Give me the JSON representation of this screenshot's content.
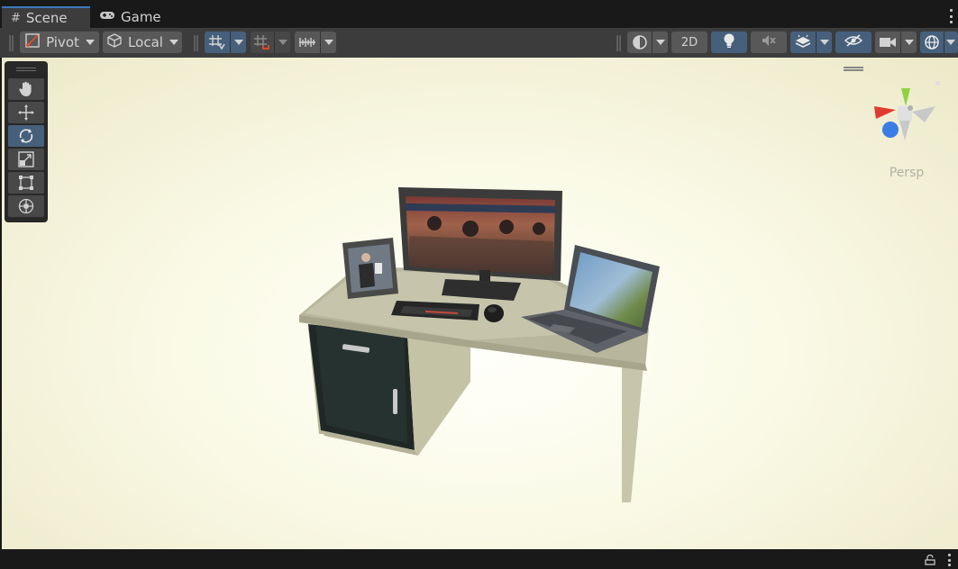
{
  "tabs": [
    {
      "label": "Scene",
      "icon": "hash-icon",
      "active": true
    },
    {
      "label": "Game",
      "icon": "gamepad-icon",
      "active": false
    }
  ],
  "toolbar": {
    "pivot_label": "Pivot",
    "space_label": "Local",
    "mode_2d_label": "2D",
    "toggles": {
      "grid_snapping": true,
      "increment_snap": false,
      "lighting": true,
      "audio": false,
      "effects": true,
      "scene_visibility": true,
      "gizmos": true
    }
  },
  "tools": [
    {
      "name": "hand-tool",
      "icon": "hand-icon",
      "active": false
    },
    {
      "name": "move-tool",
      "icon": "move-arrows-icon",
      "active": false
    },
    {
      "name": "rotate-tool",
      "icon": "rotate-icon",
      "active": true
    },
    {
      "name": "scale-tool",
      "icon": "scale-icon",
      "active": false
    },
    {
      "name": "rect-tool",
      "icon": "rect-transform-icon",
      "active": false
    },
    {
      "name": "transform-tool",
      "icon": "transform-icon",
      "active": false
    }
  ],
  "viewport": {
    "projection_label": "Persp",
    "scene_objects": [
      "desk",
      "monitor",
      "laptop",
      "keyboard",
      "mouse",
      "photo-frame"
    ]
  },
  "colors": {
    "accent": "#3a79bb",
    "toggle_on": "#46607c",
    "toolbar_bg": "#3c3c3c",
    "gizmo_x": "#e03a2f",
    "gizmo_y": "#8fd140",
    "gizmo_z": "#3b7de6"
  }
}
